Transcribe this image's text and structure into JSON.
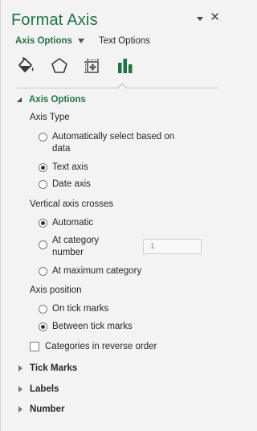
{
  "pane": {
    "title": "Format Axis",
    "tabs": {
      "active": "Axis Options",
      "other": "Text Options"
    },
    "icons": [
      "fill-line-icon",
      "effects-pentagon-icon",
      "size-properties-icon",
      "axis-options-bar-icon"
    ]
  },
  "axis_options": {
    "header": "Axis Options",
    "axis_type": {
      "label": "Axis Type",
      "auto_line1": "Automatically select based on",
      "auto_line2": "data",
      "text_axis": "Text axis",
      "date_axis": "Date axis",
      "selected": "Text axis"
    },
    "vertical_crosses": {
      "label": "Vertical axis crosses",
      "automatic": "Automatic",
      "at_category_line1": "At category",
      "at_category_line2": "number",
      "category_number_value": "1",
      "at_max": "At maximum category",
      "selected": "Automatic"
    },
    "axis_position": {
      "label": "Axis position",
      "on_tick": "On tick marks",
      "between_tick": "Between tick marks",
      "selected": "Between tick marks"
    },
    "reverse_order": "Categories in reverse order"
  },
  "collapsed_sections": {
    "tick_marks": "Tick Marks",
    "labels": "Labels",
    "number": "Number"
  },
  "colors": {
    "accent": "#217346"
  }
}
